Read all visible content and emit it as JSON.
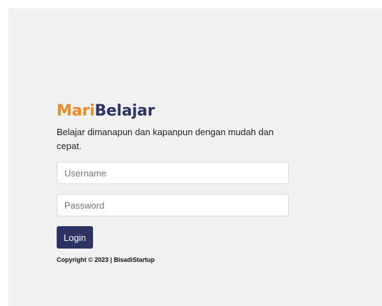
{
  "brand": {
    "part1": "Mari",
    "part2": "Belajar"
  },
  "tagline": "Belajar dimanapun dan kapanpun dengan mudah dan cepat.",
  "form": {
    "username_placeholder": "Username",
    "password_placeholder": "Password",
    "login_label": "Login"
  },
  "footer": {
    "copyright": "Copyright © 2023 | BisadiStartup"
  },
  "colors": {
    "brand_orange": "#f08a24",
    "brand_navy": "#2b3462",
    "page_background": "#f1f1f1"
  }
}
